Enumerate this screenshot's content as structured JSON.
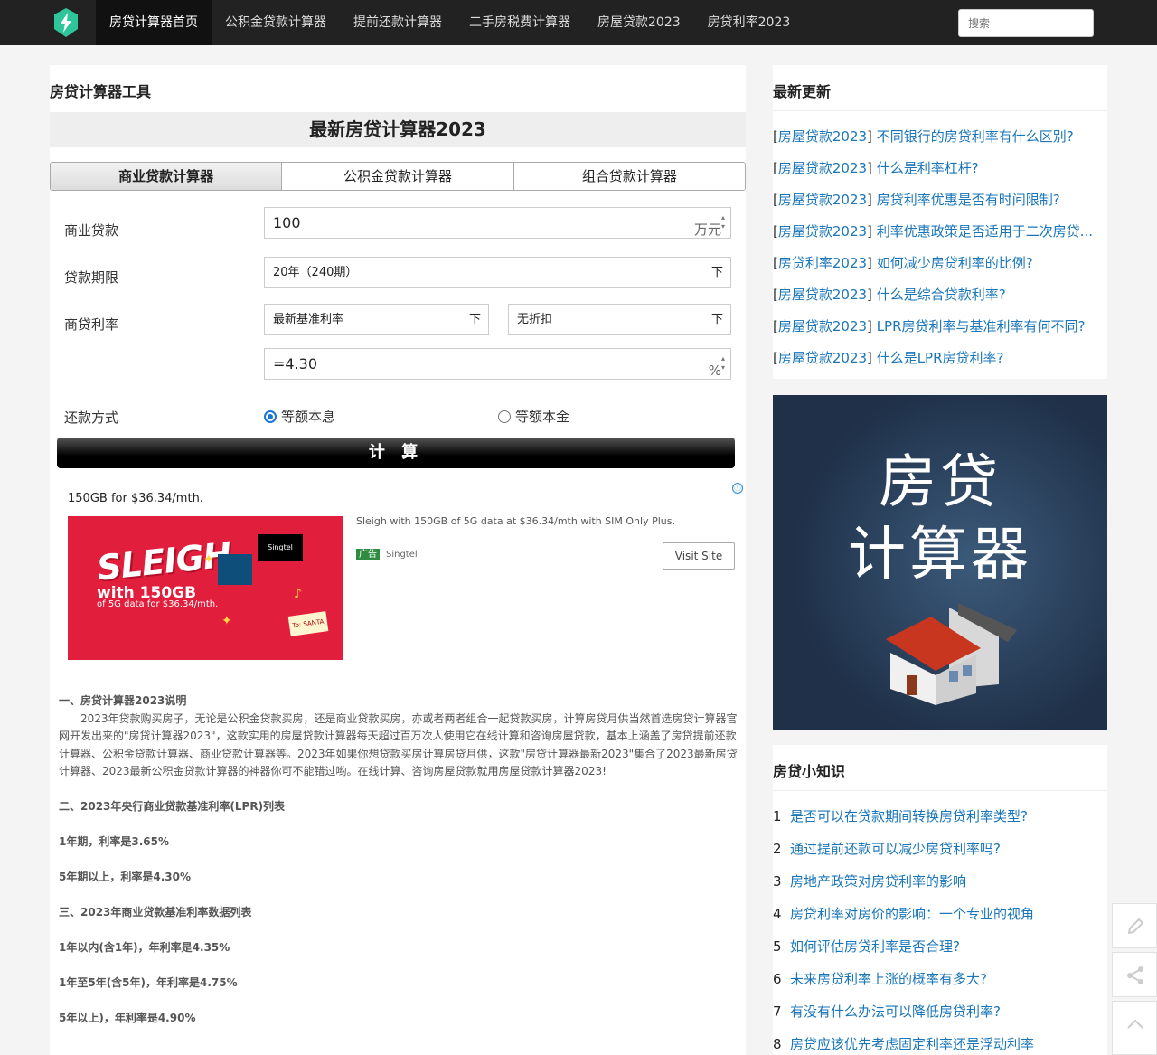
{
  "nav": {
    "items": [
      "房贷计算器首页",
      "公积金贷款计算器",
      "提前还款计算器",
      "二手房税费计算器",
      "房屋贷款2023",
      "房贷利率2023"
    ],
    "search_placeholder": "搜索"
  },
  "main": {
    "title": "房贷计算器工具",
    "calc_title": "最新房贷计算器2023",
    "tabs": [
      "商业贷款计算器",
      "公积金贷款计算器",
      "组合贷款计算器"
    ],
    "loan_label": "商业贷款",
    "loan_value": "100",
    "loan_unit": "万元",
    "term_label": "贷款期限",
    "term_value": "20年（240期）",
    "rate_label": "商贷利率",
    "rate_type": "最新基准利率",
    "rate_discount": "无折扣",
    "rate_value": "=4.30",
    "rate_unit": "%",
    "repay_label": "还款方式",
    "repay_option1": "等额本息",
    "repay_option2": "等额本金",
    "calc_button": "计 算"
  },
  "ad": {
    "headline": "150GB for $36.34/mth.",
    "image_text_big": "SLEIGH",
    "image_text_with": "with 150GB",
    "image_text_sub": "of 5G data for $36.34/mth.",
    "image_brand": "Singtel",
    "image_tag": "To: SANTA",
    "description": "Sleigh with 150GB of 5G data at $36.34/mth with SIM Only Plus.",
    "badge": "广告",
    "advertiser": "Singtel",
    "visit_label": "Visit Site",
    "info_icon": "ⓘ"
  },
  "article": {
    "h1": "一、房贷计算器2023说明",
    "p1": "2023年贷款购买房子，无论是公积金贷款买房，还是商业贷款买房，亦或者两者组合一起贷款买房，计算房贷月供当然首选房贷计算器官网开发出来的\"房贷计算器2023\"，这款实用的房屋贷款计算器每天超过百万次人使用它在线计算和咨询房屋贷款，基本上涵盖了房贷提前还款计算器、公积金贷款计算器、商业贷款计算器等。2023年如果你想贷款买房计算房贷月供，这款\"房贷计算器最新2023\"集合了2023最新房贷计算器、2023最新公积金贷款计算器的神器你可不能错过哟。在线计算、咨询房屋贷款就用房屋贷款计算器2023!",
    "h2": "二、2023年央行商业贷款基准利率(LPR)列表",
    "l1": "1年期，利率是3.65%",
    "l2": "5年期以上，利率是4.30%",
    "h3": "三、2023年商业贷款基准利率数据列表",
    "l3": "1年以内(含1年)，年利率是4.35%",
    "l4": "1年至5年(含5年)，年利率是4.75%",
    "l5": "5年以上)，年利率是4.90%"
  },
  "sidebar": {
    "updates_title": "最新更新",
    "updates": [
      {
        "cat": "房屋贷款2023",
        "title": "不同银行的房贷利率有什么区别?"
      },
      {
        "cat": "房屋贷款2023",
        "title": "什么是利率杠杆?"
      },
      {
        "cat": "房屋贷款2023",
        "title": "房贷利率优惠是否有时间限制?"
      },
      {
        "cat": "房屋贷款2023",
        "title": "利率优惠政策是否适用于二次房贷..."
      },
      {
        "cat": "房贷利率2023",
        "title": "如何减少房贷利率的比例?"
      },
      {
        "cat": "房屋贷款2023",
        "title": "什么是综合贷款利率?"
      },
      {
        "cat": "房屋贷款2023",
        "title": "LPR房贷利率与基准利率有何不同?"
      },
      {
        "cat": "房屋贷款2023",
        "title": "什么是LPR房贷利率?"
      }
    ],
    "promo_line1": "房贷",
    "promo_line2": "计算器",
    "knowledge_title": "房贷小知识",
    "knowledge": [
      {
        "num": "1",
        "title": "是否可以在贷款期间转换房贷利率类型?"
      },
      {
        "num": "2",
        "title": "通过提前还款可以减少房贷利率吗?"
      },
      {
        "num": "3",
        "title": "房地产政策对房贷利率的影响"
      },
      {
        "num": "4",
        "title": "房贷利率对房价的影响：一个专业的视角"
      },
      {
        "num": "5",
        "title": "如何评估房贷利率是否合理?"
      },
      {
        "num": "6",
        "title": "未来房贷利率上涨的概率有多大?"
      },
      {
        "num": "7",
        "title": "有没有什么办法可以降低房贷利率?"
      },
      {
        "num": "8",
        "title": "房贷应该优先考虑固定利率还是浮动利率"
      }
    ]
  },
  "icons": {
    "logo": "lightning-logo-icon",
    "edit": "pencil-icon",
    "share": "share-icon",
    "top": "chevron-up-icon"
  },
  "colors": {
    "nav_bg": "#222222",
    "link": "#1a76b8",
    "radio_selected": "#1976d2",
    "ad_bg": "#e21e3d"
  }
}
